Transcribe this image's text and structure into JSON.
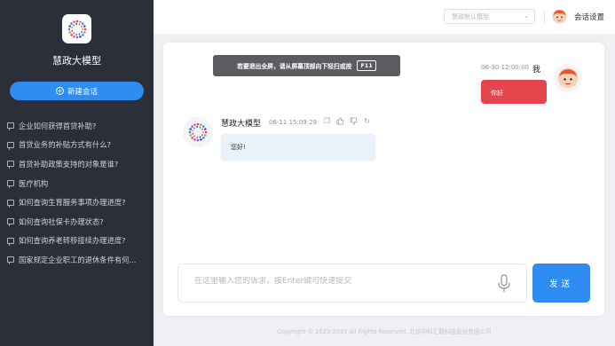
{
  "sidebar": {
    "title": "慧政大模型",
    "new_chat_label": "新建会话",
    "history": [
      "企业如何获得首贷补助?",
      "首贷业务的补贴方式有什么?",
      "首贷补助政策支持的对象是谁?",
      "医疗机构",
      "如何查询生育服务事项办理进度?",
      "如何查询社保卡办理状态?",
      "如何查询养老转移接续办理进度?",
      "国家规定企业职工的退休条件有何..."
    ]
  },
  "header": {
    "model_select_placeholder": "慧政默认模型",
    "settings_label": "会话设置"
  },
  "toast": {
    "text": "若要退出全屏，请从屏幕顶部向下轻扫或按",
    "key": "F11"
  },
  "messages": {
    "user": {
      "name": "我",
      "time": "06-30 12:00:00",
      "text": "你好"
    },
    "bot": {
      "name": "慧政大模型",
      "time": "06-11 15:09:29",
      "text": "您好!"
    }
  },
  "input": {
    "placeholder": "在这里输入您的诉求，按Enter键可快速提交",
    "send_label": "发送"
  },
  "footer": {
    "text": "Copyright © 2023-2033 All Rights Reserved. 北京中科汇联科技股份有限公司"
  },
  "colors": {
    "primary": "#2f8cf0",
    "user_bubble": "#e5464d",
    "sidebar_bg": "#2b2f3a",
    "bot_bubble": "#e9f1fb"
  },
  "icons": [
    "logo-icon",
    "plus-icon",
    "chat-icon",
    "chevron-down-icon",
    "user-avatar-icon",
    "copy-icon",
    "thumbs-up-icon",
    "thumbs-down-icon",
    "refresh-icon",
    "microphone-icon"
  ]
}
